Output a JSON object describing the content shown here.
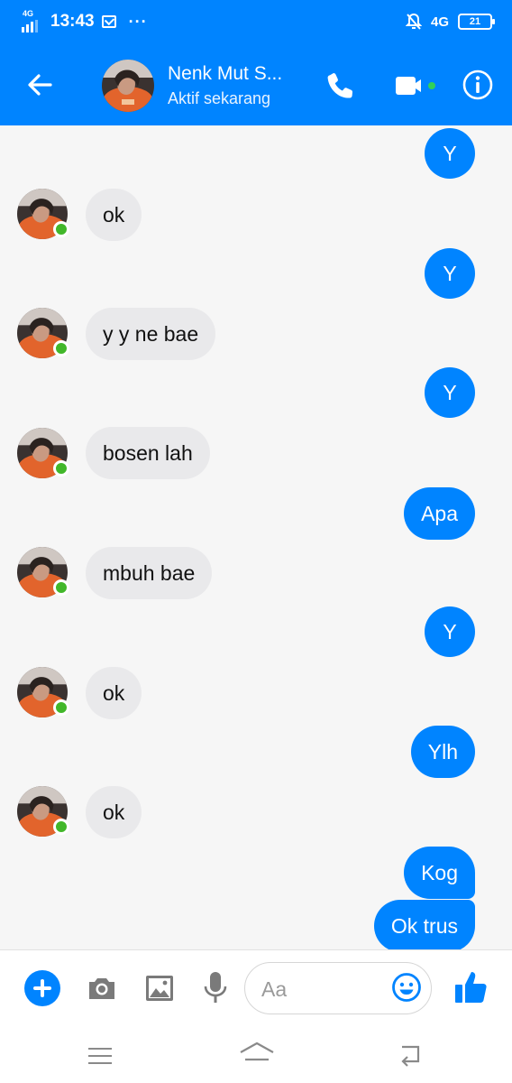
{
  "status_bar": {
    "network_left": "4G",
    "time": "13:43",
    "more": "···",
    "network_right": "4G",
    "battery": "21"
  },
  "header": {
    "contact_name": "Nenk Mut S...",
    "presence": "Aktif sekarang"
  },
  "messages": [
    {
      "side": "out",
      "text": "Y"
    },
    {
      "side": "in",
      "text": "ok"
    },
    {
      "side": "out",
      "text": "Y"
    },
    {
      "side": "in",
      "text": "y y ne bae"
    },
    {
      "side": "out",
      "text": "Y"
    },
    {
      "side": "in",
      "text": "bosen lah"
    },
    {
      "side": "out",
      "text": "Apa"
    },
    {
      "side": "in",
      "text": "mbuh bae"
    },
    {
      "side": "out",
      "text": "Y"
    },
    {
      "side": "in",
      "text": "ok"
    },
    {
      "side": "out",
      "text": "Ylh"
    },
    {
      "side": "in",
      "text": "ok"
    },
    {
      "side": "out",
      "text": "Kog"
    },
    {
      "side": "out",
      "text": "Ok trus"
    }
  ],
  "composer": {
    "placeholder": "Aa"
  },
  "colors": {
    "brand_blue": "#0084ff",
    "incoming_bubble": "#e9e9eb",
    "online_dot": "#42b72a",
    "presence_dot": "#31d158"
  }
}
